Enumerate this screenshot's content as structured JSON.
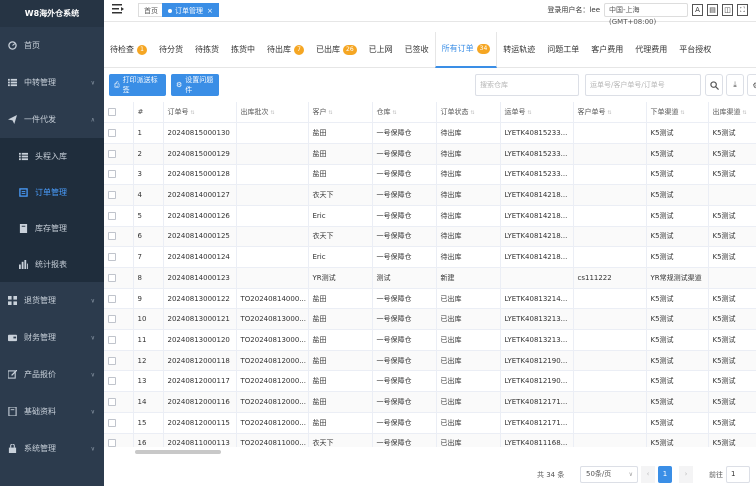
{
  "sidebar": {
    "brand": "W8海外仓系统",
    "items": [
      {
        "label": "首页",
        "icon": "dashboard-icon"
      },
      {
        "label": "中转管理",
        "icon": "list-icon"
      },
      {
        "label": "一件代发",
        "icon": "send-icon"
      }
    ],
    "sub_items": [
      {
        "label": "头程入库",
        "icon": "list-icon"
      },
      {
        "label": "订单管理",
        "icon": "order-icon"
      },
      {
        "label": "库存管理",
        "icon": "inventory-icon"
      },
      {
        "label": "统计报表",
        "icon": "chart-icon"
      }
    ],
    "items_after": [
      {
        "label": "退货管理",
        "icon": "grid-icon"
      },
      {
        "label": "财务管理",
        "icon": "wallet-icon"
      },
      {
        "label": "产品报价",
        "icon": "edit-icon"
      },
      {
        "label": "基础资料",
        "icon": "book-icon"
      },
      {
        "label": "系统管理",
        "icon": "lock-icon"
      }
    ]
  },
  "topbar": {
    "crumb_home": "首页",
    "crumb_active": "订单管理",
    "user_label": "登录用户名：lee",
    "timezone": "中国-上海 (GMT+08:00)"
  },
  "tabs": [
    {
      "label": "待检查",
      "badge": "1"
    },
    {
      "label": "待分货",
      "badge": ""
    },
    {
      "label": "待拣货",
      "badge": ""
    },
    {
      "label": "拣货中",
      "badge": ""
    },
    {
      "label": "待出库",
      "badge": "7"
    },
    {
      "label": "已出库",
      "badge": "26"
    },
    {
      "label": "已上网",
      "badge": ""
    },
    {
      "label": "已签收",
      "badge": ""
    },
    {
      "label": "所有订单",
      "badge": "34"
    },
    {
      "label": "转运轨迹",
      "badge": ""
    },
    {
      "label": "问题工单",
      "badge": ""
    },
    {
      "label": "客户费用",
      "badge": ""
    },
    {
      "label": "代理费用",
      "badge": ""
    },
    {
      "label": "平台授权",
      "badge": ""
    }
  ],
  "toolbar": {
    "print_label": "打印派送标签",
    "settings_label": "设置问题件",
    "warehouse_placeholder": "搜索仓库",
    "number_placeholder": "运单号/客户单号/订单号"
  },
  "table": {
    "columns": [
      "#",
      "订单号",
      "出库批次",
      "客户",
      "仓库",
      "订单状态",
      "运单号",
      "客户单号",
      "下单渠道",
      "出库渠道"
    ],
    "rows": [
      [
        "1",
        "20240815000130",
        "",
        "盐田",
        "一号保障仓",
        "待出库",
        "LYETK40815233...",
        "",
        "K5测试",
        "K5测试"
      ],
      [
        "2",
        "20240815000129",
        "",
        "盐田",
        "一号保障仓",
        "待出库",
        "LYETK40815233...",
        "",
        "K5测试",
        "K5测试"
      ],
      [
        "3",
        "20240815000128",
        "",
        "盐田",
        "一号保障仓",
        "待出库",
        "LYETK40815233...",
        "",
        "K5测试",
        "K5测试"
      ],
      [
        "4",
        "20240814000127",
        "",
        "衣天下",
        "一号保障仓",
        "待出库",
        "LYETK40814218...",
        "",
        "K5测试",
        ""
      ],
      [
        "5",
        "20240814000126",
        "",
        "Eric",
        "一号保障仓",
        "待出库",
        "LYETK40814218...",
        "",
        "K5测试",
        "K5测试"
      ],
      [
        "6",
        "20240814000125",
        "",
        "衣天下",
        "一号保障仓",
        "待出库",
        "LYETK40814218...",
        "",
        "K5测试",
        "K5测试"
      ],
      [
        "7",
        "20240814000124",
        "",
        "Eric",
        "一号保障仓",
        "待出库",
        "LYETK40814218...",
        "",
        "K5测试",
        "K5测试"
      ],
      [
        "8",
        "20240814000123",
        "",
        "YR测试",
        "测试",
        "新建",
        "",
        "cs111222",
        "YR常规测试渠道",
        ""
      ],
      [
        "9",
        "20240813000122",
        "TO20240814000...",
        "盐田",
        "一号保障仓",
        "已出库",
        "LYETK40813214...",
        "",
        "K5测试",
        "K5测试"
      ],
      [
        "10",
        "20240813000121",
        "TO20240813000...",
        "盐田",
        "一号保障仓",
        "已出库",
        "LYETK40813213...",
        "",
        "K5测试",
        "K5测试"
      ],
      [
        "11",
        "20240813000120",
        "TO20240813000...",
        "盐田",
        "一号保障仓",
        "已出库",
        "LYETK40813213...",
        "",
        "K5测试",
        "K5测试"
      ],
      [
        "12",
        "20240812000118",
        "TO20240812000...",
        "盐田",
        "一号保障仓",
        "已出库",
        "LYETK40812190...",
        "",
        "K5测试",
        "K5测试"
      ],
      [
        "13",
        "20240812000117",
        "TO20240812000...",
        "盐田",
        "一号保障仓",
        "已出库",
        "LYETK40812190...",
        "",
        "K5测试",
        "K5测试"
      ],
      [
        "14",
        "20240812000116",
        "TO20240812000...",
        "盐田",
        "一号保障仓",
        "已出库",
        "LYETK40812171...",
        "",
        "K5测试",
        "K5测试"
      ],
      [
        "15",
        "20240812000115",
        "TO20240812000...",
        "盐田",
        "一号保障仓",
        "已出库",
        "LYETK40812171...",
        "",
        "K5测试",
        "K5测试"
      ],
      [
        "16",
        "20240811000113",
        "TO20240811000...",
        "衣天下",
        "一号保障仓",
        "已出库",
        "LYETK40811168...",
        "",
        "K5测试",
        "K5测试"
      ]
    ]
  },
  "pager": {
    "total": "共 34 条",
    "page_size": "50条/页",
    "current": "1",
    "goto_label": "前往",
    "goto_value": "1"
  },
  "colors": {
    "sidebar_bg": "#2c3b4d",
    "accent": "#3a8ee6",
    "badge": "#f5a623"
  }
}
